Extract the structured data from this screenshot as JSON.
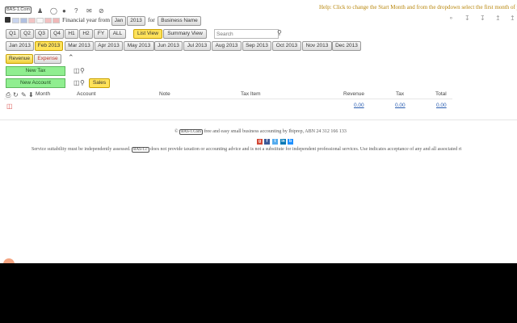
{
  "header": {
    "logo": "BAS-1.Com",
    "help_text": "Help: Click to change the Start Month and from the dropdown select the first month of your"
  },
  "fy_bar": {
    "label_from": "Financial year from",
    "month": "Jan",
    "year": "2013",
    "label_for": "for",
    "business": "Business Name"
  },
  "period_buttons": [
    "Q1",
    "Q2",
    "Q3",
    "Q4",
    "H1",
    "H2",
    "FY",
    "ALL"
  ],
  "views": {
    "list": "List View",
    "summary": "Summary View"
  },
  "search": {
    "placeholder": "Search"
  },
  "months": [
    "Jan 2013",
    "Feb 2013",
    "Mar 2013",
    "Apr 2013",
    "May 2013",
    "Jun 2013",
    "Jul 2013",
    "Aug 2013",
    "Sep 2013",
    "Oct 2013",
    "Nov 2013",
    "Dec 2013"
  ],
  "selected_month": "Feb 2013",
  "type_tabs": {
    "revenue": "Revenue",
    "expense": "Expense"
  },
  "actions": {
    "new_tax": "New Tax",
    "new_account": "New Account",
    "sales": "Sales"
  },
  "table": {
    "columns": {
      "month": "Month",
      "account": "Account",
      "note": "Note",
      "tax_item": "Tax Item",
      "revenue": "Revenue",
      "tax": "Tax",
      "total": "Total"
    },
    "row": {
      "revenue": "0.00",
      "tax": "0.00",
      "total": "0.00"
    }
  },
  "footer": {
    "copyright_symbol": "©",
    "logo": "BAS-1.Com",
    "line1": "free and easy small business accounting by Ibiprep, ABN 24 312 166 133",
    "line2_pre": "Service suitability must be independently assessed.",
    "logo2": "BAS-1.c",
    "line2_post": "does not provide taxation or accounting advice and is not a substitute for independent professional services. Use indicates acceptance of any and all associated ri"
  },
  "colors": {
    "accent_yellow": "#ffe25a",
    "green": "#90ee90",
    "help_text": "#b8860b"
  },
  "icons": [
    "user-icon",
    "coin-icon",
    "person-icon",
    "help-icon",
    "mail-icon",
    "hide-icon",
    "share-icon",
    "download-icon",
    "download2-icon",
    "upload-icon",
    "upload2-icon",
    "expand-icon",
    "print-icon",
    "refresh-icon",
    "edit-icon",
    "down-arrow-icon",
    "trash-icon",
    "search-icon"
  ]
}
